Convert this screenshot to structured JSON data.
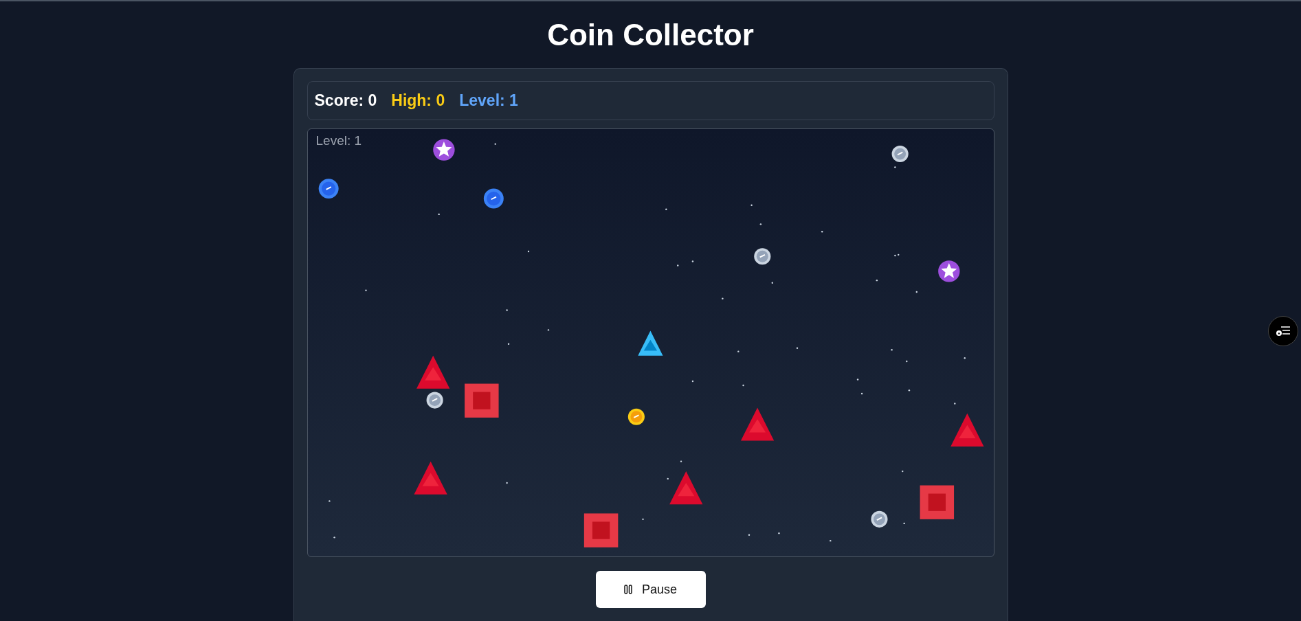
{
  "title": "Coin Collector",
  "stats": [
    {
      "kind": "score",
      "text": "Score: 0"
    },
    {
      "kind": "high",
      "text": "High: 0"
    },
    {
      "kind": "level",
      "text": "Level: 1"
    }
  ],
  "game_field": {
    "overlay_label": "Level: 1"
  },
  "controls": {
    "pause_button": "Pause"
  }
}
